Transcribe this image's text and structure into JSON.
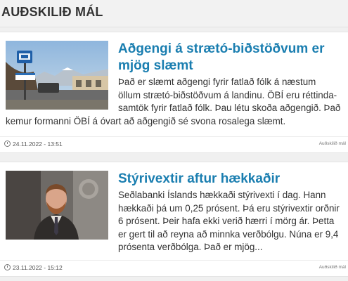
{
  "section": {
    "title": "AUÐSKILIÐ MÁL"
  },
  "articles": [
    {
      "headline": "Aðgengi á strætó-biðstöðvum er mjög slæmt",
      "excerpt": "Það er slæmt aðgengi fyrir fatlað fólk á næstum öllum strætó-biðstöðvum á landinu. ÖBÍ eru réttinda-samtök fyrir fatlað fólk. Þau létu skoða aðgengið. Það kemur formanni ÖBÍ á óvart að aðgengið sé svona rosalega slæmt.",
      "date": "24.11.2022 - 13:51",
      "category": "Auðskilið mál",
      "thumbnail_icon": "bus-stop-photo"
    },
    {
      "headline": "Stýrivextir aftur hækkaðir",
      "excerpt": "Seðlabanki Íslands hækkaði stýrivexti í dag. Hann hækkaði þá um 0,25 prósent. Þá eru stýrivextir orðnir 6 prósent. Þeir hafa ekki verið hærri í mörg ár. Þetta er gert til að reyna að minnka verðbólgu. Núna er 9,4 prósenta verðbólga. Það er mjög...",
      "date": "23.11.2022 - 15:12",
      "category": "Auðskilið mál",
      "thumbnail_icon": "portrait-photo"
    }
  ],
  "colors": {
    "headline": "#1a7eb0",
    "background": "#f0f0f0",
    "card": "#ffffff"
  }
}
